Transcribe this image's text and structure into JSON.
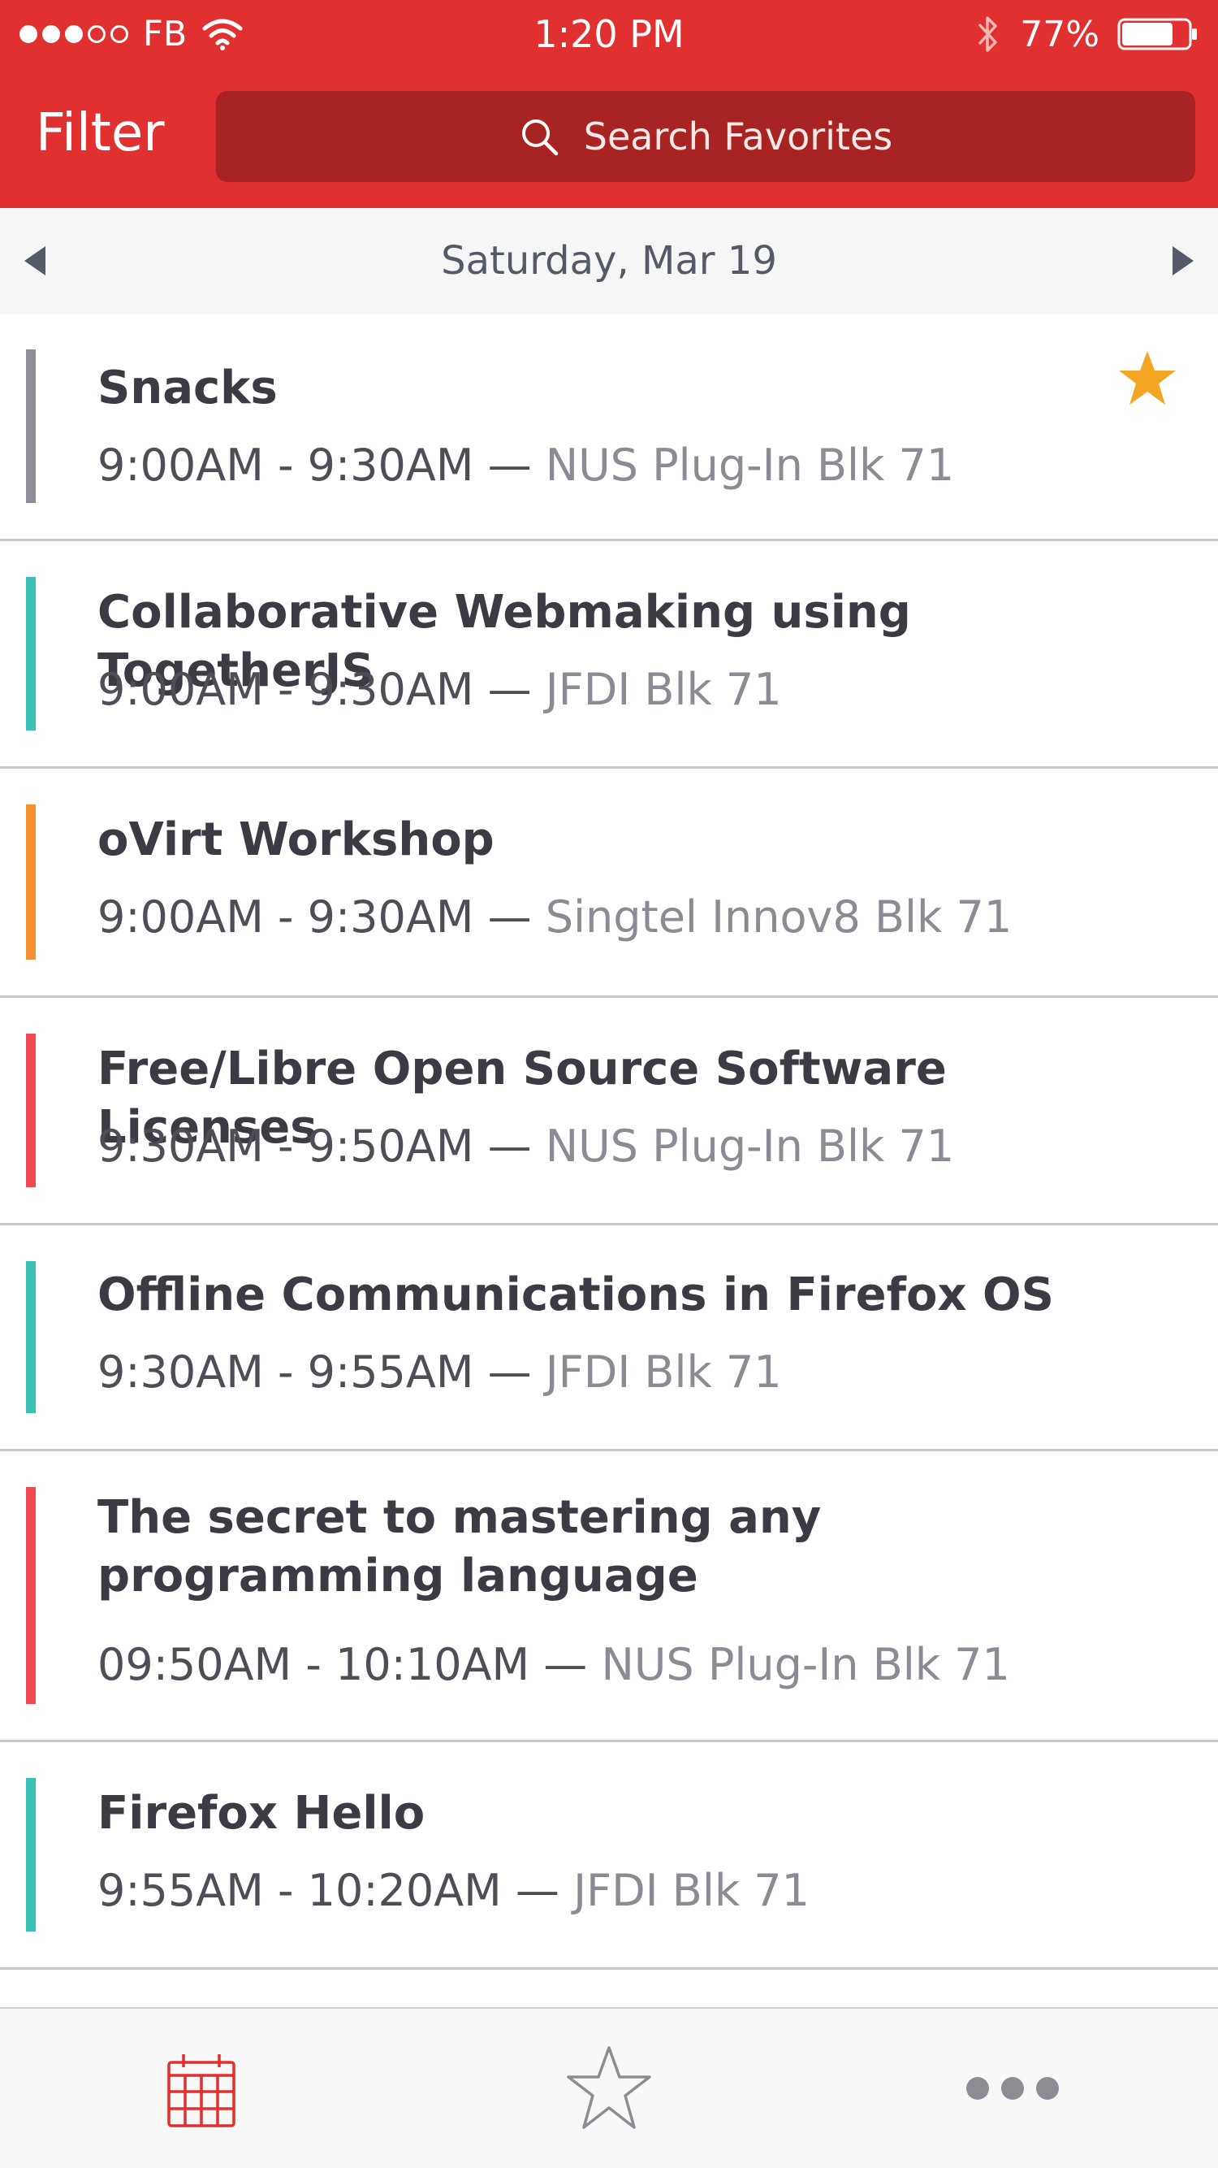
{
  "status_bar": {
    "carrier": "FB",
    "time": "1:20 PM",
    "battery": "77%",
    "signal_filled": 3,
    "signal_total": 5,
    "battery_level": 0.77
  },
  "header": {
    "filter_label": "Filter",
    "search_placeholder": "Search Favorites",
    "color": "#e0302f"
  },
  "date_nav": {
    "date": "Saturday, Mar 19"
  },
  "sessions": [
    {
      "title": "Snacks",
      "time": "9:00AM - 9:30AM",
      "sep": " — ",
      "location": "NUS Plug-In Blk 71",
      "color": "#8e8e96",
      "favorite": true
    },
    {
      "title": "Collaborative Webmaking using TogetherJS",
      "time": "9:00AM - 9:30AM",
      "sep": " — ",
      "location": "JFDI Blk 71",
      "color": "#3cc1b9",
      "favorite": false
    },
    {
      "title": "oVirt Workshop",
      "time": "9:00AM - 9:30AM",
      "sep": " — ",
      "location": "Singtel Innov8 Blk 71",
      "color": "#f5922f",
      "favorite": false
    },
    {
      "title": "Free/Libre Open Source Software Licenses",
      "time": "9:30AM - 9:50AM",
      "sep": " — ",
      "location": "NUS Plug-In Blk 71",
      "color": "#f04a55",
      "favorite": false
    },
    {
      "title": "Offline Communications in Firefox OS",
      "time": "9:30AM - 9:55AM",
      "sep": " — ",
      "location": "JFDI Blk 71",
      "color": "#3cc1b9",
      "favorite": false
    },
    {
      "title": "The secret to mastering any programming language",
      "time": "09:50AM - 10:10AM",
      "sep": " — ",
      "location": "NUS Plug-In Blk 71",
      "color": "#f04a55",
      "favorite": false
    },
    {
      "title": "Firefox Hello",
      "time": "9:55AM - 10:20AM",
      "sep": " — ",
      "location": "JFDI Blk 71",
      "color": "#3cc1b9",
      "favorite": false
    }
  ],
  "colors": {
    "favorite_star": "#f2a623",
    "schedule_tab": "#e0302f",
    "inactive_tab": "#8c8c92",
    "partial_next_bar": "#3a8fd6"
  },
  "tabs": [
    {
      "icon": "calendar-icon",
      "active": true
    },
    {
      "icon": "star-outline-icon",
      "active": false
    },
    {
      "icon": "more-dots-icon",
      "active": false
    }
  ]
}
